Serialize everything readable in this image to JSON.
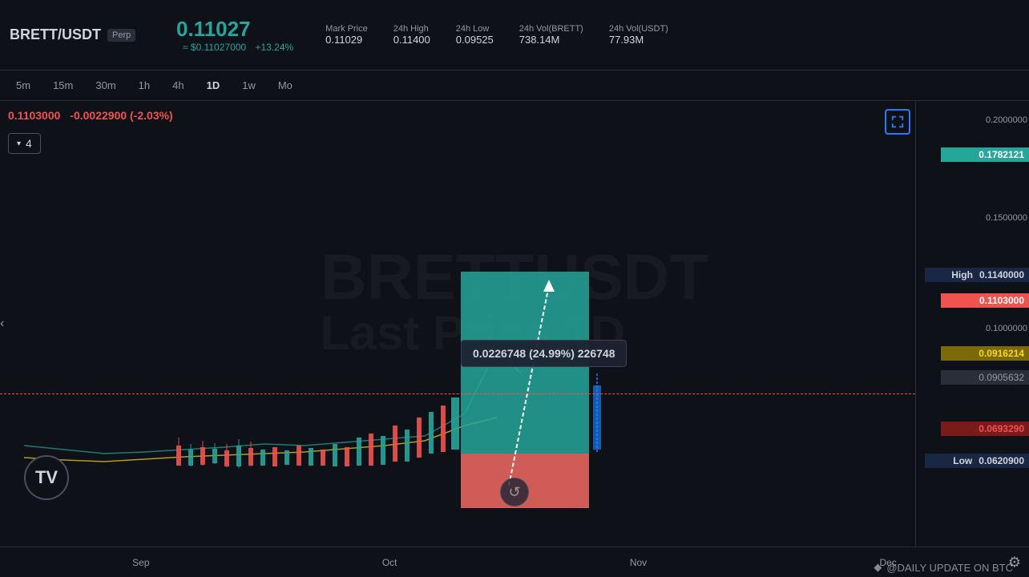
{
  "header": {
    "pair": "BRETT/USDT",
    "type": "Perp",
    "main_price": "0.11027",
    "usd_price": "≈ $0.11027000",
    "change": "+13.24%",
    "mark_price_label": "Mark Price",
    "mark_price_value": "0.11029",
    "high_24h_label": "24h High",
    "high_24h_value": "0.11400",
    "low_24h_label": "24h Low",
    "low_24h_value": "0.09525",
    "vol_brett_label": "24h Vol(BRETT)",
    "vol_brett_value": "738.14M",
    "vol_usdt_label": "24h Vol(USDT)",
    "vol_usdt_value": "77.93M"
  },
  "timeframes": [
    "5m",
    "15m",
    "30m",
    "1h",
    "4h",
    "1D",
    "1w",
    "Mo"
  ],
  "active_timeframe": "1D",
  "chart": {
    "price_display": "0.1103000",
    "price_change": "-0.0022900 (-2.03%)",
    "dropdown_value": "4",
    "tooltip": "0.0226748 (24.99%) 226748",
    "watermark_line1": "BRETTUSDT",
    "watermark_line2": "Last Price  1D"
  },
  "price_levels": {
    "p1": "0.2000000",
    "p2": "0.1782121",
    "p3": "0.1500000",
    "p4": "0.1140000",
    "p5": "0.1103000",
    "p6": "0.1000000",
    "p7": "0.0916214",
    "p8": "0.0905632",
    "p9": "0.0693290",
    "p10": "0.0620900",
    "high_label": "High",
    "high_value": "0.1140000",
    "low_label": "Low",
    "low_value": "0.0620900"
  },
  "time_labels": [
    "Sep",
    "Oct",
    "Nov",
    "Dec"
  ],
  "bottom_watermark": "@DAILY UPDATE ON BTC",
  "tv_logo": "TV"
}
